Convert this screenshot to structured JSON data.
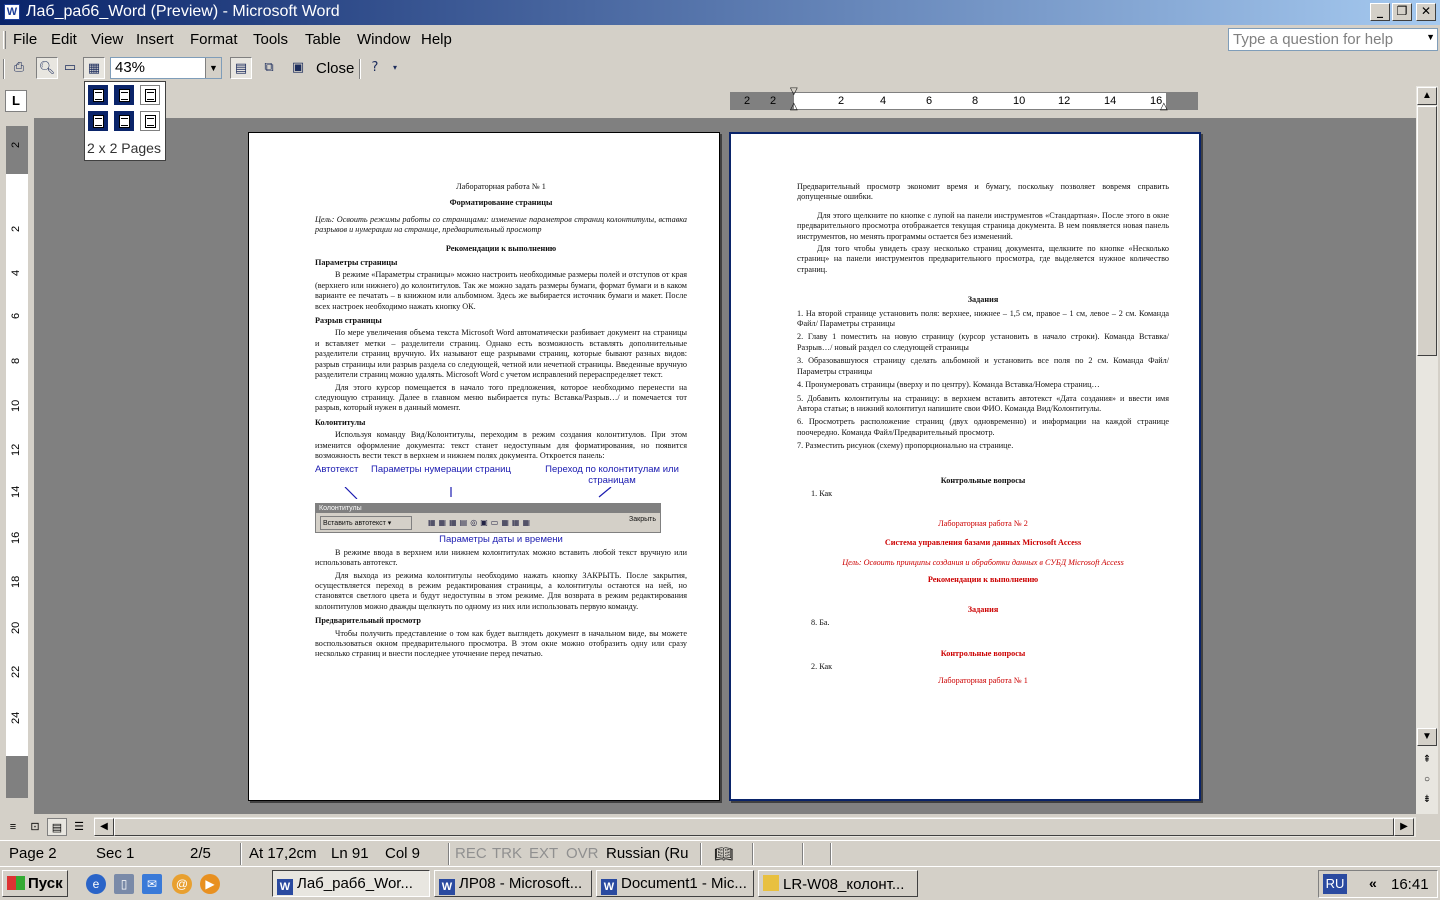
{
  "window": {
    "title": "Лаб_раб6_Word (Preview) - Microsoft Word",
    "app_icon": "W",
    "controls": {
      "minimize": "_",
      "restore": "❐",
      "close": "✕"
    }
  },
  "menubar": {
    "items": [
      "File",
      "Edit",
      "View",
      "Insert",
      "Format",
      "Tools",
      "Table",
      "Window",
      "Help"
    ],
    "help_placeholder": "Type a question for help",
    "doc_close": "✕"
  },
  "toolbar": {
    "zoom": "43%",
    "close_label": "Close",
    "icons": [
      "print-icon",
      "magnifier-icon",
      "one-page-icon",
      "multiple-pages-icon",
      "ruler-icon",
      "shrink-to-fit-icon",
      "full-screen-icon",
      "context-help-icon"
    ]
  },
  "multipage_popup": {
    "label": "2 x 2 Pages"
  },
  "ruler": {
    "h_ticks": [
      "2",
      "2",
      "2",
      "4",
      "6",
      "8",
      "10",
      "12",
      "14",
      "16"
    ],
    "v_ticks": [
      "2",
      "2",
      "4",
      "6",
      "8",
      "10",
      "12",
      "14",
      "16",
      "18",
      "20",
      "22",
      "24"
    ],
    "tab_selector": "L"
  },
  "page_left": {
    "title": "Лабораторная работа № 1",
    "subtitle": "Форматирование страницы",
    "goal": "Цель: Освоить режимы работы со страницами: изменение параметров страниц колонтитулы, вставка разрывов и нумерации на странице, предварительный просмотр",
    "recs": "Рекомендации к выполнению",
    "h1": "Параметры страницы",
    "p1": "В режиме «Параметры страницы» можно настроить необходимые размеры полей и отступов от края (верхнего или нижнего) до колонтитулов. Так же можно задать размеры бумаги, формат бумаги и в каком варианте ее печатать – в книжном или альбомном. Здесь же выбирается источник бумаги и макет. После всех настроек необходимо нажать кнопку ОК.",
    "h2": "Разрыв страницы",
    "p2": "По мере увеличения объема текста Microsoft Word автоматически разбивает документ на страницы и вставляет метки – разделители страниц. Однако есть возможность вставлять дополнительные разделители страниц вручную. Их называют еще разрывами страниц, которые бывают разных видов: разрыв страницы или разрыв раздела со следующей, четной или нечетной страницы. Введенные вручную разделители страниц можно удалять. Microsoft Word с учетом исправлений перераспределяет текст.",
    "p3": "Для этого курсор помещается в начало того предложения, которое необходимо перенести на следующую страницу. Далее в главном меню выбирается путь: Вставка/Разрыв…/ и помечается тот разрыв, который нужен в данный момент.",
    "h3": "Колонтитулы",
    "p4": "Используя команду Вид/Колонтитулы, переходим в режим создания колонтитулов. При этом изменится оформление документа: текст станет недоступным для форматирования, но появится возможность вести текст в верхнем и нижнем полях документа. Откроется панель:",
    "lbl_autotext": "Автотекст",
    "lbl_numbering": "Параметры нумерации страниц",
    "lbl_transition": "Переход по колонтитулам или страницам",
    "kol_title": "Колонтитулы",
    "kol_insert": "Вставить автотекст ▾",
    "kol_close": "Закрыть",
    "lbl_datetime": "Параметры даты и времени",
    "p5": "В режиме ввода в верхнем или нижнем колонтитулах можно вставить любой текст вручную или использовать автотекст.",
    "p6": "Для выхода из режима колонтитулы необходимо нажать кнопку ЗАКРЫТЬ. После закрытия, осуществляется переход в режим редактирования страницы, а колонтитулы остаются на ней, но становятся светлого цвета и будут недоступны в этом режиме. Для возврата в режим редактирования колонтитулов можно дважды щелкнуть по одному из них или использовать первую команду.",
    "h4": "Предварительный просмотр",
    "p7": "Чтобы получить представление о том как будет выглядеть документ в начальном виде, вы можете воспользоваться окном предварительного просмотра. В этом окне можно отобразить одну или сразу несколько страниц и внести последнее уточнение перед печатью."
  },
  "page_right": {
    "p1": "Предварительный просмотр экономит время и бумагу, поскольку позволяет вовремя справить допущенные ошибки.",
    "p2": "Для этого щелкните по кнопке с лупой на панели инструментов «Стандартная». После этого в окне предварительного просмотра отображается текущая страница документа. В нем появляется новая панель инструментов, но менять программы остается без изменений.",
    "p3": "Для того чтобы увидеть сразу несколько страниц документа, щелкните по кнопке «Несколько страниц» на панели инструментов предварительного просмотра, где выделяется нужное количество страниц.",
    "tasks_h": "Задания",
    "tasks": [
      "1. На второй странице установить поля: верхнее, нижнее – 1,5 см, правое – 1 см, левое – 2 см. Команда Файл/ Параметры страницы",
      "2. Главу 1 поместить на новую страницу (курсор установить в начало строки). Команда Вставка/Разрыв…/ новый раздел со следующей страницы",
      "3. Образовавшуюся страницу сделать альбомной и установить все поля по 2 см. Команда Файл/ Параметры страницы",
      "4. Пронумеровать страницы (вверху и по центру). Команда Вставка/Номера страниц…",
      "5. Добавить колонтитулы на страницу: в верхнем вставить автотекст «Дата создания» и ввести имя Автора статьи; в нижний колонтитул напишите свои ФИО. Команда Вид/Колонтитулы.",
      "6. Просмотреть расположение страниц (двух одновременно) и информации на каждой странице поочередно. Команда Файл/Предварительный просмотр.",
      "7. Разместить рисунок (схему) пропорционально на странице."
    ],
    "ctrl_h": "Контрольные вопросы",
    "ctrl_1": "1. Как",
    "lab2_title": "Лабораторная работа № 2",
    "lab2_sub": "Система управления базами данных Microsoft Access",
    "lab2_goal": "Цель: Освоить принципы создания и обработки данных в СУБД Microsoft Access",
    "lab2_recs": "Рекомендации к выполнению",
    "tasks2_h": "Задания",
    "tasks2_1": "8. Ба.",
    "ctrl2_h": "Контрольные вопросы",
    "ctrl2_1": "2. Как",
    "lab1_again": "Лабораторная работа № 1"
  },
  "statusbar": {
    "page": "Page 2",
    "sec": "Sec 1",
    "count": "2/5",
    "at": "At 17,2cm",
    "ln": "Ln 91",
    "col": "Col 9",
    "rec": "REC",
    "trk": "TRK",
    "ext": "EXT",
    "ovr": "OVR",
    "lang": "Russian (Ru"
  },
  "taskbar": {
    "start": "Пуск",
    "tasks": [
      "Лаб_раб6_Wor...",
      "ЛР08 - Microsoft...",
      "Document1 - Mic...",
      "LR-W08_колонт..."
    ],
    "lang": "RU",
    "time": "16:41"
  }
}
